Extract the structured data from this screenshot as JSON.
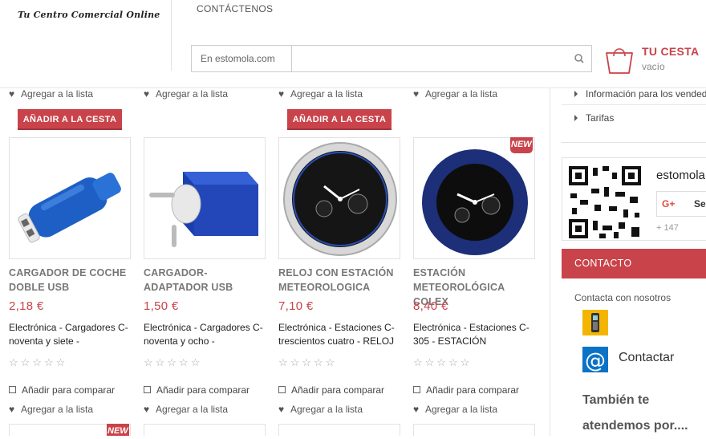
{
  "header": {
    "logo_text": "Tu Centro Comercial Online",
    "nav_contact": "CONTÁCTENOS",
    "search": {
      "scope": "En estomola.com",
      "placeholder": "",
      "button_icon": "search-icon"
    },
    "cart": {
      "title": "TU CESTA",
      "status": "vacío",
      "icon": "shopping-bag-icon"
    }
  },
  "colors": {
    "accent": "#c9434a",
    "text_gray": "#777777"
  },
  "top_row": {
    "wishlist_label": "Agregar a la lista",
    "add_to_cart_label": "AÑADIR A LA CESTA"
  },
  "products": [
    {
      "name": "CARGADOR DE COCHE DOBLE USB",
      "price": "2,18 €",
      "desc": "Electrónica - Cargadores C-noventa y siete -",
      "compare": "Añadir para comparar",
      "wishlist": "Agregar a la lista",
      "rating": "☆☆☆☆☆"
    },
    {
      "name": "CARGADOR-ADAPTADOR USB",
      "price": "1,50 €",
      "desc": "Electrónica - Cargadores C-noventa y ocho -",
      "compare": "Añadir para comparar",
      "wishlist": "Agregar a la lista",
      "rating": "☆☆☆☆☆"
    },
    {
      "name": "RELOJ CON ESTACIÓN METEOROLOGICA",
      "price": "7,10 €",
      "desc": "Electrónica - Estaciones C-trescientos cuatro - RELOJ",
      "compare": "Añadir para comparar",
      "wishlist": "Agregar a la lista",
      "rating": "☆☆☆☆☆"
    },
    {
      "name": "ESTACIÓN METEOROLÓGICA COLEX",
      "price": "8,40 €",
      "desc": "Electrónica - Estaciones C-305 - ESTACIÓN",
      "compare": "Añadir para comparar",
      "wishlist": "Agregar a la lista",
      "rating": "☆☆☆☆☆",
      "badge": "NEW"
    }
  ],
  "next_row": {
    "badge": "NEW"
  },
  "sidebar": {
    "links": [
      "Información para los vendedores",
      "Tarifas"
    ],
    "brand": "estomola",
    "gplus_label": "Se",
    "gplus_icon": "G+",
    "followers": "+ 147",
    "contact_heading": "CONTACTO",
    "contact_sub": "Contacta con nosotros",
    "contact_link": "Contactar",
    "also_text": "También te atendemos por...."
  }
}
